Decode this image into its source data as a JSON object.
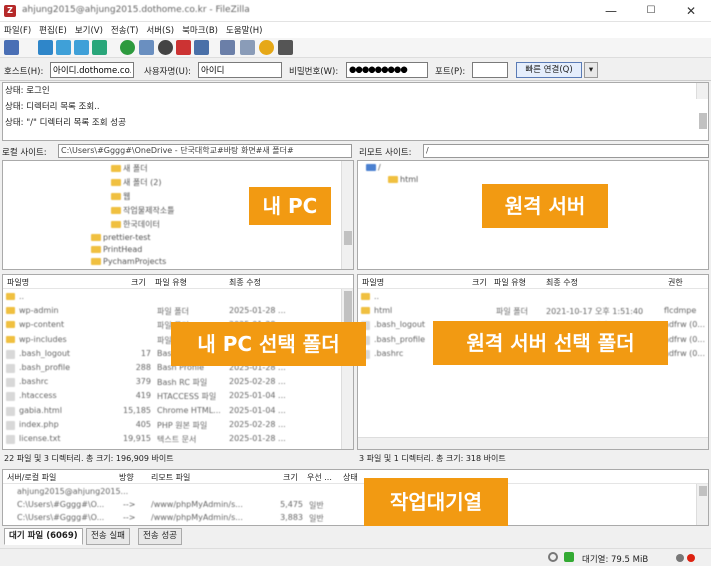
{
  "window": {
    "title": "ahjung2015@ahjung2015.dothome.co.kr - FileZilla",
    "icon": "filezilla-icon",
    "min": "—",
    "max": "☐",
    "close": "✕"
  },
  "menu": [
    "파일(F)",
    "편집(E)",
    "보기(V)",
    "전송(T)",
    "서버(S)",
    "북마크(B)",
    "도움말(H)"
  ],
  "quickconnect": {
    "host_label": "호스트(H):",
    "host_value": "아이디.dothome.co.kr",
    "user_label": "사용자명(U):",
    "user_value": "아이디",
    "pass_label": "비밀번호(W):",
    "pass_value": "●●●●●●●●●",
    "port_label": "포트(P):",
    "port_value": "",
    "connect_label": "빠른 연결(Q)",
    "dropdown": "▾"
  },
  "log": [
    {
      "label": "상태:",
      "text": "로그인"
    },
    {
      "label": "상태:",
      "text": "디렉터리 목록 조회.."
    },
    {
      "label": "상태:",
      "text": "\"/\" 디렉터리 목록 조회 성공"
    }
  ],
  "local": {
    "site_label": "로컬 사이트:",
    "site_path": "C:\\Users\\#Gggg#\\OneDrive - 단국대학교#바탕 화면#새 폴더#",
    "tree": [
      {
        "label": "새 폴더"
      },
      {
        "label": "새 폴더 (2)"
      },
      {
        "label": "웹"
      },
      {
        "label": "작업물제작소틀"
      },
      {
        "label": "한국데이터"
      },
      {
        "label": "prettier-test"
      },
      {
        "label": "PrintHead"
      },
      {
        "label": "PychamProjects"
      }
    ],
    "headers": [
      "파일명",
      "크기",
      "파일 유형",
      "최종 수정"
    ],
    "files": [
      {
        "name": "..",
        "size": "",
        "type": "",
        "date": ""
      },
      {
        "name": "wp-admin",
        "size": "",
        "type": "파일 폴더",
        "date": "2025-01-28 ..."
      },
      {
        "name": "wp-content",
        "size": "",
        "type": "파일 폴더",
        "date": "2025-01-28 ..."
      },
      {
        "name": "wp-includes",
        "size": "",
        "type": "파일 폴더",
        "date": "2025-01-28 ..."
      },
      {
        "name": ".bash_logout",
        "size": "17",
        "type": "Bash Logout",
        "date": "2025-01-28 ..."
      },
      {
        "name": ".bash_profile",
        "size": "288",
        "type": "Bash Profile",
        "date": "2025-01-28 ..."
      },
      {
        "name": ".bashrc",
        "size": "379",
        "type": "Bash RC 파일",
        "date": "2025-02-28 ..."
      },
      {
        "name": ".htaccess",
        "size": "419",
        "type": "HTACCESS 파일",
        "date": "2025-01-04 ..."
      },
      {
        "name": "gabia.html",
        "size": "15,185",
        "type": "Chrome HTML...",
        "date": "2025-01-04 ..."
      },
      {
        "name": "index.php",
        "size": "405",
        "type": "PHP 원본 파일",
        "date": "2025-02-28 ..."
      },
      {
        "name": "license.txt",
        "size": "19,915",
        "type": "텍스트 문서",
        "date": "2025-01-28 ..."
      }
    ],
    "status": "22 파일 및 3 디렉터리. 총 크기: 196,909 바이트"
  },
  "remote": {
    "site_label": "리모트 사이트:",
    "site_path": "/",
    "tree": [
      {
        "label": "/"
      },
      {
        "label": "html"
      }
    ],
    "headers": [
      "파일명",
      "크기",
      "파일 유형",
      "최종 수정",
      "권한"
    ],
    "files": [
      {
        "name": "..",
        "size": "",
        "type": "",
        "date": "",
        "perm": ""
      },
      {
        "name": "html",
        "size": "",
        "type": "파일 폴더",
        "date": "2021-10-17 오후 1:51:40",
        "perm": "flcdmpe"
      },
      {
        "name": ".bash_logout",
        "size": "",
        "type": "",
        "date": "2021-10-17 오후 ...",
        "perm": "adfrw (0..."
      },
      {
        "name": ".bash_profile",
        "size": "",
        "type": "",
        "date": "2021-10-17 오후 ...",
        "perm": "adfrw (0..."
      },
      {
        "name": ".bashrc",
        "size": "",
        "type": "",
        "date": "2021-10-17 오후 ...",
        "perm": "adfrw (0..."
      }
    ],
    "status": "3 파일 및 1 디렉터리. 총 크기: 318 바이트"
  },
  "queue": {
    "headers": [
      "서버/로컬 파일",
      "방향",
      "리모트 파일",
      "크기",
      "우선 ...",
      "상태"
    ],
    "rows": [
      {
        "server": "ahjung2015@ahjung2015...",
        "dir": "",
        "remote": "",
        "size": "",
        "prio": "",
        "status": ""
      },
      {
        "server": "C:\\Users\\#Gggg#\\O...",
        "dir": "-->",
        "remote": "/www/phpMyAdmin/s...",
        "size": "5,475",
        "prio": "일반",
        "status": ""
      },
      {
        "server": "C:\\Users\\#Gggg#\\O...",
        "dir": "-->",
        "remote": "/www/phpMyAdmin/s...",
        "size": "3,883",
        "prio": "일반",
        "status": ""
      }
    ]
  },
  "tabs": [
    "대기 파일 (6069)",
    "전송 실패",
    "전송 성공"
  ],
  "statusbar": {
    "queue_size": "대기열: 79.5 MiB"
  },
  "annotations": {
    "local_pc": "내 PC",
    "remote_server": "원격 서버",
    "local_folder": "내 PC 선택 폴더",
    "remote_folder": "원격 서버 선택 폴더",
    "queue": "작업대기열"
  },
  "colors": {
    "annotation_bg": "#f29a12",
    "folder": "#f0c040"
  }
}
